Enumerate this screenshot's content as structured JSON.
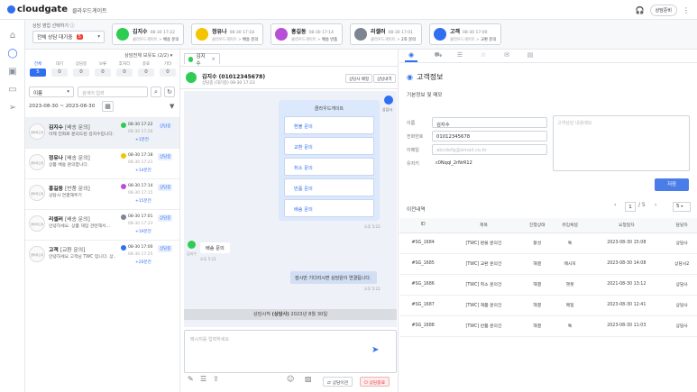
{
  "topbar": {
    "logo": "cloudgate",
    "tenant": "클라우드게이트",
    "status": "상담준비"
  },
  "nav": {
    "icons": [
      "home-icon",
      "chat-icon",
      "contacts-icon",
      "folder-icon",
      "send-icon"
    ]
  },
  "cardbar": {
    "select_label": "상담 영업 선택하기 ⓘ",
    "select_value": "전체 상담 대기중",
    "select_count": "5",
    "cards": [
      {
        "name": "김지수",
        "time": "08-30 17:22",
        "source": "클라우드게이트",
        "target": "배송 문의",
        "color": "#2ecc52",
        "initial": "●"
      },
      {
        "name": "정유나",
        "time": "08-30 17:18",
        "source": "클라우드게이트",
        "target": "배송 문의",
        "color": "#f5c400",
        "initial": "●"
      },
      {
        "name": "홍길동",
        "time": "08-30 17:14",
        "source": "클라우드게이트",
        "target": "배송 반품",
        "color": "#b84fd6",
        "initial": "●"
      },
      {
        "name": "리셀러",
        "time": "08-30 17:01",
        "source": "클라우드게이트",
        "target": "2차 문의",
        "color": "#7c8591",
        "initial": "●"
      },
      {
        "name": "고객",
        "time": "08-30 17:00",
        "source": "클라우드게이트",
        "target": "교환 문의",
        "color": "#2f6ff0",
        "initial": "●"
      }
    ]
  },
  "list": {
    "title": "상담전체 보유도 (2/2) ▾",
    "stats": [
      {
        "label": "전체",
        "value": "5"
      },
      {
        "label": "대기",
        "value": "0"
      },
      {
        "label": "상담중",
        "value": "0"
      },
      {
        "label": "보류",
        "value": "0"
      },
      {
        "label": "후처리",
        "value": "0"
      },
      {
        "label": "종료",
        "value": "0"
      },
      {
        "label": "기타",
        "value": "0"
      }
    ],
    "filter_select": "이름",
    "search_placeholder": "검색어 입력",
    "date_range": "2023-08-30 ~ 2023-08-30",
    "rows": [
      {
        "name": "김지수",
        "tag": "[배송 문의]",
        "msg": "이제 전화로 문의드린 김지수입니다.",
        "t1": "08-30 17:22",
        "t2": "08-30 17:26",
        "t3": "+1분전",
        "agent": "상담중",
        "ch": "#2ecc52",
        "av": "클라우드게이트"
      },
      {
        "name": "정유나",
        "tag": "[배송 문의]",
        "msg": "상품 배송 문의합니다.",
        "t1": "08-30 17:18",
        "t2": "08-30 17:21",
        "t3": "+14분전",
        "agent": "상담중",
        "ch": "#f5c400",
        "av": "클라우드게이트"
      },
      {
        "name": "홍길동",
        "tag": "[반품 문의]",
        "msg": "상담사 연결해주기",
        "t1": "08-30 17:14",
        "t2": "08-30 17:15",
        "t3": "+15분전",
        "agent": "상담중",
        "ch": "#b84fd6",
        "av": "클라우드게이트"
      },
      {
        "name": "리셀러",
        "tag": "[배송 문의]",
        "msg": "안녕하세요. 상품 재입 관련해서...",
        "t1": "08-30 17:01",
        "t2": "08-30 17:23",
        "t3": "+19분전",
        "agent": "상담중",
        "ch": "#7c8591",
        "av": "클라우드게이트"
      },
      {
        "name": "고객",
        "tag": "[교환 문의]",
        "msg": "안녕하세요 고객님 TWC 입니다. 상...",
        "t1": "08-30 17:00",
        "t2": "08-30 17:25",
        "t3": "+20분전",
        "agent": "상담중",
        "ch": "#2f6ff0",
        "av": "클라우드게이트"
      }
    ]
  },
  "chat": {
    "tab": "김지수",
    "name": "김지수 (01012345678)",
    "sub": "상담중 (대기중)  08-30 17:23",
    "btn_transfer": "상담사 배정",
    "btn_history": "상담내역",
    "bot_name": "클라우드게이트",
    "bot_label": "상담사",
    "options": [
      "환불 문의",
      "교환 문의",
      "취소 문의",
      "반품 문의",
      "배송 문의"
    ],
    "bot_time": "오후 5:22",
    "customer_msg": "배송 문의",
    "customer_label": "김지수",
    "customer_time": "오후 5:22",
    "sys_msg": "잠시만 기다리시면 상담원이 연결됩니다.",
    "sys_time": "오후 5:22",
    "start_prefix": "상담시작 ",
    "start_bold": "(상담사)",
    "start_date": " 2023년 8월 30일",
    "input_placeholder": "메시지를 입력하세요",
    "btn_transfer2": "상담이관",
    "btn_end": "상담종료"
  },
  "right": {
    "tabs": [
      "user-icon",
      "cart-icon",
      "list-icon",
      "star-icon",
      "mail-icon",
      "doc-icon"
    ],
    "title": "고객정보",
    "section": "기본정보 및 메모",
    "fields": [
      {
        "label": "이름",
        "value": "김지수",
        "ph": false
      },
      {
        "label": "전화번호",
        "value": "01012345678",
        "ph": false
      },
      {
        "label": "이메일",
        "value": "abcdefg@email.co.kr",
        "ph": true
      },
      {
        "label": "유저키",
        "value": "c0Nqql_2rNrR12",
        "ph": false,
        "plain": true
      }
    ],
    "memo_placeholder": "고객상담 내용메모",
    "save": "저장",
    "history_title": "이전내역",
    "page": "1",
    "pages": "/ 5",
    "page_size": "5",
    "columns": [
      "ID",
      "제목",
      "진행상태",
      "유입채널",
      "요청일자",
      "담당자"
    ],
    "rows": [
      [
        "#SG_1684",
        "[TWC] 환불 문의건",
        "활성",
        "톡",
        "2023-08-30 15:08",
        "상담사"
      ],
      [
        "#SG_1685",
        "[TWC] 교환 문의건",
        "해결",
        "메시지",
        "2023-08-30 14:08",
        "상담사2"
      ],
      [
        "#SG_1686",
        "[TWC] 취소 문의건",
        "해결",
        "챗봇",
        "2021-08-30 13:12",
        "상담사"
      ],
      [
        "#SG_1687",
        "[TWC] 재품 문의건",
        "해결",
        "메일",
        "2023-08-30 12:41",
        "상담사"
      ],
      [
        "#SG_1688",
        "[TWC] 반품 문의건",
        "해결",
        "톡",
        "2023-08-30 11:03",
        "상담사"
      ]
    ]
  }
}
